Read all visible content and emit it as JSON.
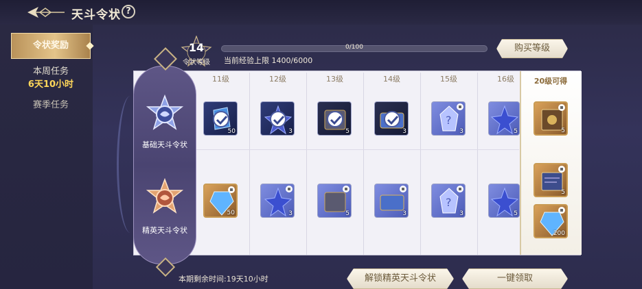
{
  "header": {
    "title": "天斗令状",
    "help_icon": "?"
  },
  "sidebar": {
    "tabs": [
      {
        "label": "令状奖励",
        "active": true
      },
      {
        "label": "本周任务",
        "sub": "6天10小时"
      },
      {
        "label": "赛季任务"
      }
    ]
  },
  "level": {
    "value": "14",
    "label": "令状等级",
    "exp_progress_text": "0/100",
    "exp_fraction": 0,
    "exp_cap": "当前经验上限 1400/6000",
    "buy_label": "购买等级"
  },
  "columns": [
    "11级",
    "12级",
    "13级",
    "14级",
    "15级",
    "16级"
  ],
  "final_column": "20级可得",
  "passes": [
    {
      "name": "基础天斗令状"
    },
    {
      "name": "精英天斗令状"
    }
  ],
  "rewards": {
    "basic": [
      {
        "icon": "blue-shard-icon",
        "qty": "50",
        "claimed": true
      },
      {
        "icon": "star-crystal-icon",
        "qty": "3",
        "claimed": true
      },
      {
        "icon": "chest-icon",
        "qty": "5",
        "claimed": true
      },
      {
        "icon": "treasure-box-icon",
        "qty": "3",
        "claimed": true
      },
      {
        "icon": "mystery-crystal-icon",
        "qty": "3",
        "locked": true
      },
      {
        "icon": "star-crystal-icon",
        "qty": "5",
        "locked": false
      }
    ],
    "elite": [
      {
        "icon": "blue-gem-icon",
        "qty": "50",
        "locked": true
      },
      {
        "icon": "star-crystal-icon",
        "qty": "3",
        "locked": true
      },
      {
        "icon": "chest-icon",
        "qty": "5",
        "locked": true
      },
      {
        "icon": "treasure-box-icon",
        "qty": "3",
        "locked": true
      },
      {
        "icon": "mystery-crystal-icon",
        "qty": "3",
        "locked": true
      },
      {
        "icon": "star-crystal-icon",
        "qty": "5",
        "locked": false
      }
    ],
    "final": [
      {
        "icon": "book-icon",
        "qty": "5"
      },
      {
        "icon": "spellbook-icon",
        "qty": "5"
      },
      {
        "icon": "blue-gem-icon",
        "qty": "200"
      }
    ]
  },
  "footer": {
    "remaining": "本期剩余时间:19天10小时",
    "unlock_label": "解锁精英天斗令状",
    "claim_label": "一键领取"
  }
}
